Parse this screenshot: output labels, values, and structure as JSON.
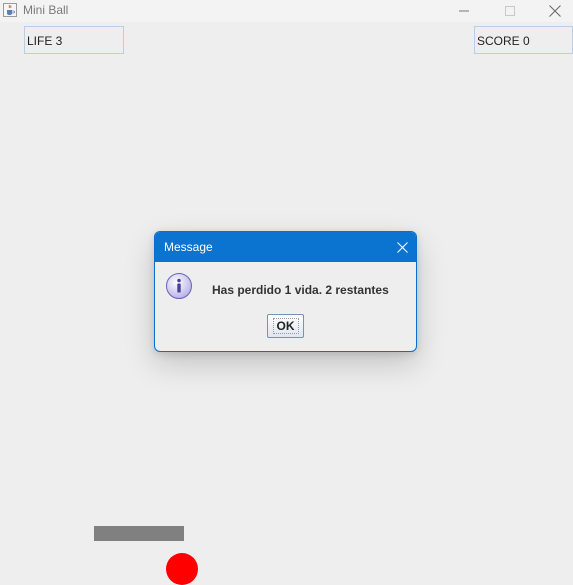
{
  "window": {
    "title": "Mini Ball",
    "icons": {
      "app": "java-coffee-cup-icon",
      "minimize": "minimize-icon",
      "maximize": "maximize-icon",
      "close": "close-icon"
    }
  },
  "hud": {
    "life": "LIFE 3",
    "score": "SCORE 0"
  },
  "game": {
    "paddle_color": "#808080",
    "ball_color": "#ff0000"
  },
  "dialog": {
    "title": "Message",
    "message": "Has perdido 1 vida. 2 restantes",
    "ok_label": "OK",
    "icon": "info-icon",
    "titlebar_color": "#0b74d1"
  }
}
